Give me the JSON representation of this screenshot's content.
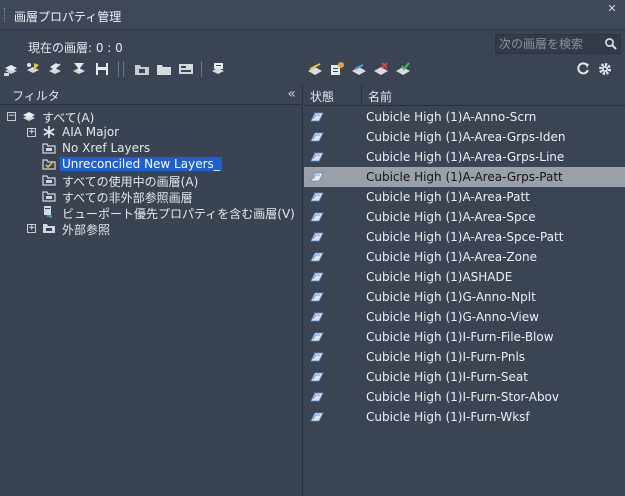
{
  "window": {
    "title": "画層プロパティ管理",
    "close_glyph": "✕"
  },
  "current_layer": "現在の画層: 0 : 0",
  "search": {
    "placeholder": "次の画層を検索",
    "value": ""
  },
  "filter_panel": {
    "header": "フィルタ",
    "collapse_glyph": "«",
    "tree": [
      {
        "label": "すべて(A)",
        "icon": "layers-stack-icon",
        "expander": "−"
      },
      {
        "label": "AIA Major",
        "icon": "snowflake-filter-icon",
        "expander": "+"
      },
      {
        "label": "No Xref Layers",
        "icon": "filter-folder-icon"
      },
      {
        "label": "Unreconciled New Layers_",
        "icon": "filter-folder-check-icon",
        "selected": true
      },
      {
        "label": "すべての使用中の画層(A)",
        "icon": "filter-folder-icon"
      },
      {
        "label": "すべての非外部参照画層",
        "icon": "filter-folder-icon"
      },
      {
        "label": "ビューポート優先プロパティを含む画層(V)",
        "icon": "viewport-override-icon"
      },
      {
        "label": "外部参照",
        "icon": "xref-folder-icon",
        "expander": "+"
      }
    ]
  },
  "layer_list": {
    "columns": [
      "状態",
      "名前"
    ],
    "rows": [
      {
        "name": "Cubicle High (1)A-Anno-Scrn"
      },
      {
        "name": "Cubicle High (1)A-Area-Grps-Iden"
      },
      {
        "name": "Cubicle High (1)A-Area-Grps-Line"
      },
      {
        "name": "Cubicle High (1)A-Area-Grps-Patt",
        "selected": true
      },
      {
        "name": "Cubicle High (1)A-Area-Patt"
      },
      {
        "name": "Cubicle High (1)A-Area-Spce"
      },
      {
        "name": "Cubicle High (1)A-Area-Spce-Patt"
      },
      {
        "name": "Cubicle High (1)A-Area-Zone"
      },
      {
        "name": "Cubicle High (1)ASHADE"
      },
      {
        "name": "Cubicle High (1)G-Anno-Nplt"
      },
      {
        "name": "Cubicle High (1)G-Anno-View"
      },
      {
        "name": "Cubicle High (1)I-Furn-File-Blow"
      },
      {
        "name": "Cubicle High (1)I-Furn-Pnls"
      },
      {
        "name": "Cubicle High (1)I-Furn-Seat"
      },
      {
        "name": "Cubicle High (1)I-Furn-Stor-Abov"
      },
      {
        "name": "Cubicle High (1)I-Furn-Wksf"
      }
    ]
  },
  "colors": {
    "background": "#3b4453",
    "selection_blue": "#1e5fd4",
    "row_selected": "#9a9fa8"
  }
}
